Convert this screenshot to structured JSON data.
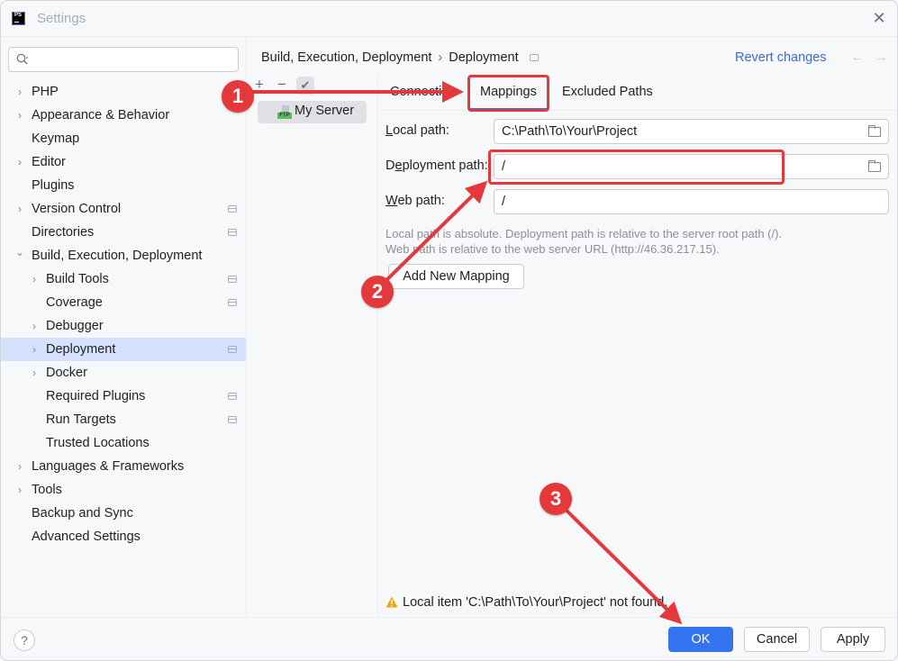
{
  "window": {
    "title": "Settings",
    "app_icon_text": "PS",
    "close_glyph": "✕"
  },
  "sidebar": {
    "search": {
      "value": "",
      "placeholder": ""
    },
    "items": [
      {
        "label": "PHP",
        "level": 0,
        "expandable": true,
        "expanded": false,
        "project_scoped": false,
        "selected": false
      },
      {
        "label": "Appearance & Behavior",
        "level": 0,
        "expandable": true,
        "expanded": false,
        "project_scoped": false,
        "selected": false
      },
      {
        "label": "Keymap",
        "level": 0,
        "expandable": false,
        "project_scoped": false,
        "selected": false
      },
      {
        "label": "Editor",
        "level": 0,
        "expandable": true,
        "expanded": false,
        "project_scoped": false,
        "selected": false
      },
      {
        "label": "Plugins",
        "level": 0,
        "expandable": false,
        "project_scoped": false,
        "selected": false
      },
      {
        "label": "Version Control",
        "level": 0,
        "expandable": true,
        "expanded": false,
        "project_scoped": true,
        "selected": false
      },
      {
        "label": "Directories",
        "level": 0,
        "expandable": false,
        "project_scoped": true,
        "selected": false
      },
      {
        "label": "Build, Execution, Deployment",
        "level": 0,
        "expandable": true,
        "expanded": true,
        "project_scoped": false,
        "selected": false
      },
      {
        "label": "Build Tools",
        "level": 1,
        "expandable": true,
        "expanded": false,
        "project_scoped": true,
        "selected": false
      },
      {
        "label": "Coverage",
        "level": 1,
        "expandable": false,
        "project_scoped": true,
        "selected": false
      },
      {
        "label": "Debugger",
        "level": 1,
        "expandable": true,
        "expanded": false,
        "project_scoped": false,
        "selected": false
      },
      {
        "label": "Deployment",
        "level": 1,
        "expandable": true,
        "expanded": false,
        "project_scoped": true,
        "selected": true
      },
      {
        "label": "Docker",
        "level": 1,
        "expandable": true,
        "expanded": false,
        "project_scoped": false,
        "selected": false
      },
      {
        "label": "Required Plugins",
        "level": 1,
        "expandable": false,
        "project_scoped": true,
        "selected": false
      },
      {
        "label": "Run Targets",
        "level": 1,
        "expandable": false,
        "project_scoped": true,
        "selected": false
      },
      {
        "label": "Trusted Locations",
        "level": 1,
        "expandable": false,
        "project_scoped": false,
        "selected": false
      },
      {
        "label": "Languages & Frameworks",
        "level": 0,
        "expandable": true,
        "expanded": false,
        "project_scoped": false,
        "selected": false
      },
      {
        "label": "Tools",
        "level": 0,
        "expandable": true,
        "expanded": false,
        "project_scoped": false,
        "selected": false
      },
      {
        "label": "Backup and Sync",
        "level": 0,
        "expandable": false,
        "project_scoped": false,
        "selected": false
      },
      {
        "label": "Advanced Settings",
        "level": 0,
        "expandable": false,
        "project_scoped": false,
        "selected": false
      }
    ]
  },
  "header": {
    "breadcrumb": [
      "Build, Execution, Deployment",
      "Deployment"
    ],
    "breadcrumb_separator": "›",
    "revert_label": "Revert changes",
    "back_glyph": "←",
    "forward_glyph": "→"
  },
  "servers": {
    "toolbar": {
      "add_glyph": "+",
      "remove_glyph": "−",
      "default_glyph": "✔"
    },
    "items": [
      {
        "name": "My Server",
        "type_badge": "FTP",
        "selected": true
      }
    ]
  },
  "tabs": [
    {
      "label": "Connection",
      "active": false
    },
    {
      "label": "Mappings",
      "active": true
    },
    {
      "label": "Excluded Paths",
      "active": false
    }
  ],
  "mapping": {
    "local_path": {
      "label_mnemonic": "L",
      "label_rest": "ocal path:",
      "value": "C:\\Path\\To\\Your\\Project"
    },
    "deployment_path": {
      "label_pre": "D",
      "label_mnemonic": "e",
      "label_rest": "ployment path:",
      "value": "/"
    },
    "web_path": {
      "label_mnemonic": "W",
      "label_rest": "eb path:",
      "value": "/"
    },
    "hint_line1": "Local path is absolute. Deployment path is relative to the server root path (/).",
    "hint_line2": "Web path is relative to the web server URL (http://46.36.217.15).",
    "add_mapping_label": "Add New Mapping"
  },
  "warning": {
    "text": "Local item 'C:\\Path\\To\\Your\\Project' not found.",
    "color": "#f2a30f"
  },
  "footer": {
    "help_glyph": "?",
    "ok_label": "OK",
    "cancel_label": "Cancel",
    "apply_label": "Apply"
  },
  "annotations": {
    "color": "#e5383b",
    "badges": [
      "1",
      "2",
      "3"
    ]
  },
  "colors": {
    "accent": "#3574f0",
    "link": "#3d6bce",
    "selection": "#d5e1fd",
    "background": "#f7f8fa"
  }
}
